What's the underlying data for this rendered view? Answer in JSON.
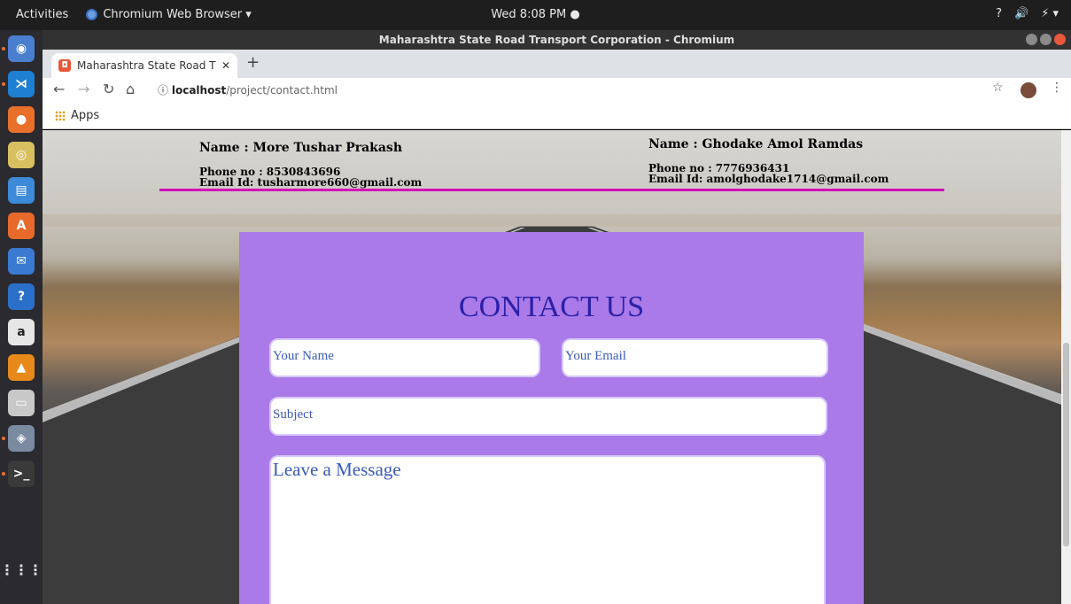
{
  "system": {
    "activities": "Activities",
    "app_name": "Chromium Web Browser ▾",
    "clock": "Wed  8:08 PM ●",
    "tray": [
      "?",
      "🔊",
      "⚡ ▾"
    ]
  },
  "launcher": {
    "items": [
      {
        "icon": "chromium-icon",
        "glyph": "◉",
        "color": "#4a7fd0"
      },
      {
        "icon": "vscode-icon",
        "glyph": "⋊",
        "color": "#1f7fd0"
      },
      {
        "icon": "firefox-icon",
        "glyph": "●",
        "color": "#e8702a"
      },
      {
        "icon": "rhythmbox-icon",
        "glyph": "◎",
        "color": "#d8c060"
      },
      {
        "icon": "document-icon",
        "glyph": "▤",
        "color": "#3c8ad8"
      },
      {
        "icon": "software-center-icon",
        "glyph": "A",
        "color": "#e86a2a"
      },
      {
        "icon": "thunderbird-icon",
        "glyph": "✉",
        "color": "#3a7ad0"
      },
      {
        "icon": "help-icon",
        "glyph": "?",
        "color": "#2a70c8"
      },
      {
        "icon": "amazon-icon",
        "glyph": "a",
        "color": "#e6e6e6"
      },
      {
        "icon": "vlc-icon",
        "glyph": "▲",
        "color": "#e88a1a"
      },
      {
        "icon": "files-icon",
        "glyph": "▭",
        "color": "#c8c8c8"
      },
      {
        "icon": "image-viewer-icon",
        "glyph": "◈",
        "color": "#7a8aa0"
      },
      {
        "icon": "terminal-icon",
        "glyph": ">_",
        "color": "#3a3a3a"
      }
    ],
    "apps_grid": "⋮⋮⋮"
  },
  "browser": {
    "window_title": "Maharashtra State Road Transport Corporation - Chromium",
    "tab_title": "Maharashtra State Road T",
    "new_tab": "+",
    "url_host": "localhost",
    "url_path": "/project/contact.html",
    "bookmarks_apps": "Apps"
  },
  "contacts": [
    {
      "name": "Name : More Tushar Prakash",
      "phone": "Phone no : 8530843696",
      "email": "Email Id: tusharmore660@gmail.com"
    },
    {
      "name": "Name : Ghodake Amol Ramdas",
      "phone": "Phone no : 7776936431",
      "email": "Email Id: amolghodake1714@gmail.com"
    }
  ],
  "form": {
    "title": "CONTACT US",
    "name_placeholder": "Your Name",
    "email_placeholder": "Your Email",
    "subject_placeholder": "Subject",
    "message_placeholder": "Leave a Message"
  },
  "colors": {
    "divider": "#d20fb8",
    "form_bg": "#a97ae8",
    "form_title": "#2b1fa8"
  }
}
